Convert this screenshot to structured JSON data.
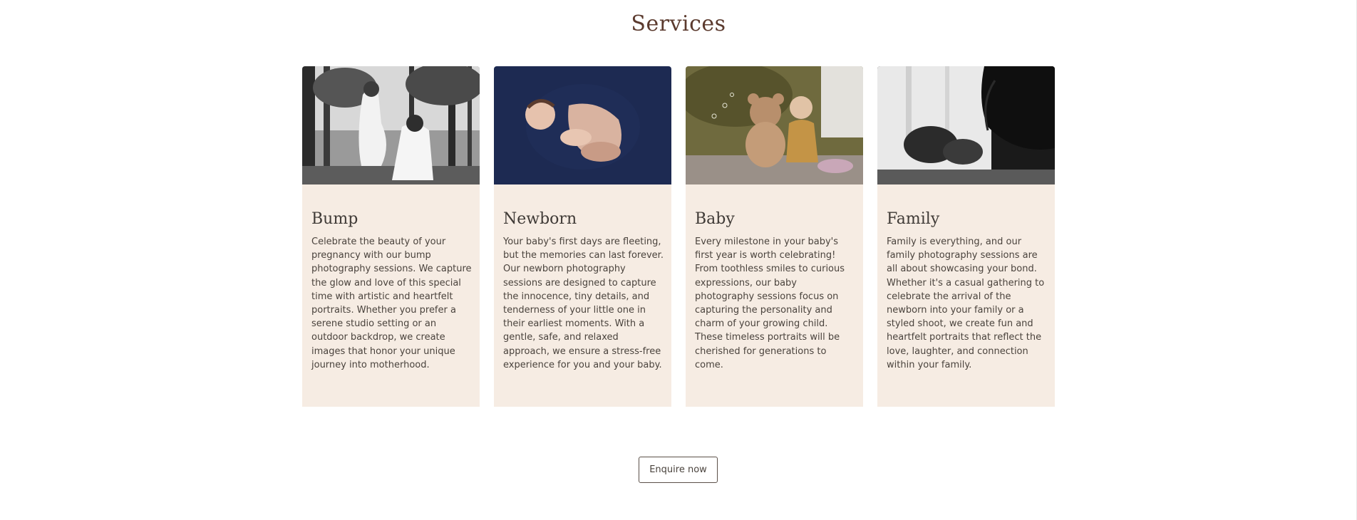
{
  "section": {
    "title": "Services"
  },
  "cards": [
    {
      "title": "Bump",
      "text": "Celebrate the beauty of your pregnancy with our bump photography sessions. We capture the glow and love of this special time with artistic and heartfelt portraits. Whether you prefer a serene studio setting or an outdoor backdrop, we create images that honor your unique journey into motherhood."
    },
    {
      "title": "Newborn",
      "text": "Your baby's first days are fleeting, but the memories can last forever. Our newborn photography sessions are designed to capture the innocence, tiny details, and tenderness of your little one in their earliest moments. With a gentle, safe, and relaxed approach, we ensure a stress-free experience for you and your baby."
    },
    {
      "title": "Baby",
      "text": "Every milestone in your baby's first year is worth celebrating! From toothless smiles to curious expressions, our baby photography sessions focus on capturing the personality and charm of your growing child. These timeless portraits will be cherished for generations to come."
    },
    {
      "title": "Family",
      "text": "Family is everything, and our family photography sessions are all about showcasing your bond. Whether it's a casual gathering to celebrate the arrival of the newborn into your family or a styled shoot, we create fun and heartfelt portraits that reflect the love, laughter, and connection within your family."
    }
  ],
  "cta": {
    "label": "Enquire now"
  },
  "colors": {
    "card_background": "#f6ece3",
    "title_color": "#5b3a2e",
    "text_color": "#4a433d"
  }
}
